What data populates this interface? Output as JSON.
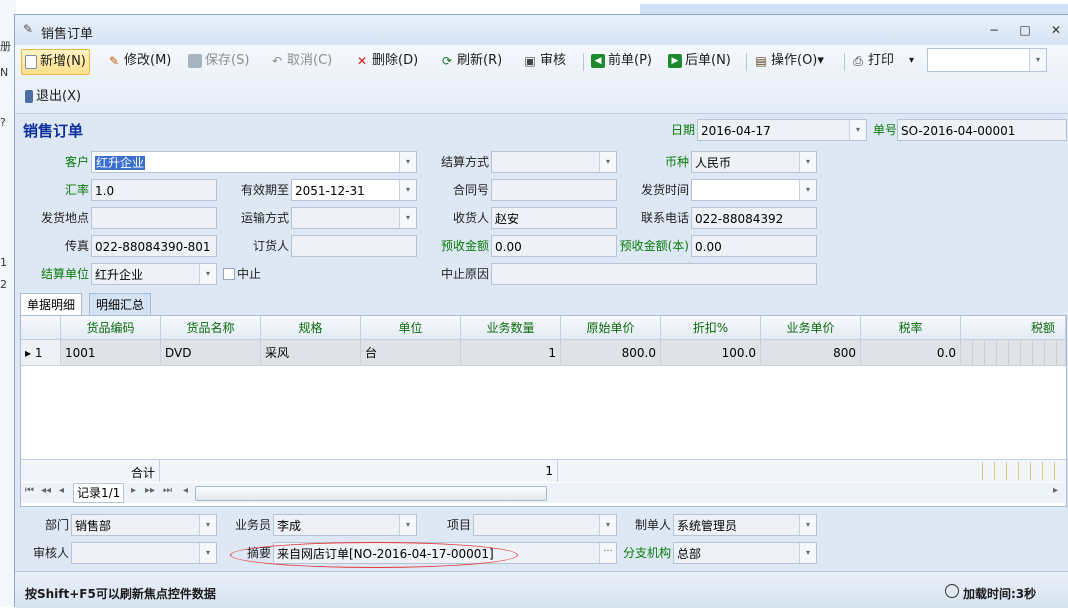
{
  "background_app": {
    "fragments": [
      "册",
      "N",
      "?",
      "1",
      "2"
    ]
  },
  "window": {
    "title": "销售订单",
    "controls": [
      "−",
      "□",
      "✕"
    ]
  },
  "toolbar": {
    "items": [
      {
        "label": "新增(N)",
        "icon": "new-doc-icon",
        "enabled": true,
        "selected": true
      },
      {
        "label": "修改(M)",
        "icon": "edit-icon",
        "enabled": true
      },
      {
        "label": "保存(S)",
        "icon": "save-icon",
        "enabled": false
      },
      {
        "label": "取消(C)",
        "icon": "undo-icon",
        "enabled": false
      },
      {
        "label": "删除(D)",
        "icon": "delete-icon",
        "enabled": true
      },
      {
        "label": "刷新(R)",
        "icon": "refresh-icon",
        "enabled": true
      },
      {
        "label": "审核",
        "icon": "audit-icon",
        "enabled": true
      },
      {
        "label": "前单(P)",
        "icon": "prev-icon",
        "enabled": true
      },
      {
        "label": "后单(N)",
        "icon": "next-icon",
        "enabled": true
      },
      {
        "label": "操作(O)▾",
        "icon": "operation-icon",
        "enabled": true
      },
      {
        "label": "打印",
        "icon": "print-icon",
        "enabled": true
      },
      {
        "label": "▾",
        "icon": "",
        "enabled": true
      },
      {
        "label": "退出(X)",
        "icon": "exit-icon",
        "enabled": true
      }
    ],
    "search_value": ""
  },
  "form": {
    "title": "销售订单",
    "date_label": "日期",
    "date_value": "2016-04-17",
    "no_label": "单号",
    "no_value": "SO-2016-04-00001",
    "fields": {
      "customer": {
        "label": "客户",
        "value": "红升企业"
      },
      "settle_method": {
        "label": "结算方式",
        "value": ""
      },
      "currency": {
        "label": "币种",
        "value": "人民币"
      },
      "rate": {
        "label": "汇率",
        "value": "1.0"
      },
      "valid_until": {
        "label": "有效期至",
        "value": "2051-12-31"
      },
      "contract_no": {
        "label": "合同号",
        "value": ""
      },
      "ship_time": {
        "label": "发货时间",
        "value": ""
      },
      "ship_place": {
        "label": "发货地点",
        "value": ""
      },
      "transport": {
        "label": "运输方式",
        "value": ""
      },
      "receiver": {
        "label": "收货人",
        "value": "赵安"
      },
      "phone": {
        "label": "联系电话",
        "value": "022-88084392"
      },
      "fax": {
        "label": "传真",
        "value": "022-88084390-801"
      },
      "orderer": {
        "label": "订货人",
        "value": ""
      },
      "prepaid": {
        "label": "预收金额",
        "value": "0.00"
      },
      "prepaid_base": {
        "label": "预收金额(本)",
        "value": "0.00"
      },
      "settle_unit": {
        "label": "结算单位",
        "value": "红升企业"
      },
      "stop_label": "中止",
      "stop_reason": {
        "label": "中止原因",
        "value": ""
      }
    }
  },
  "tabs": [
    {
      "label": "单据明细",
      "active": true
    },
    {
      "label": "明细汇总",
      "active": false
    }
  ],
  "grid": {
    "columns": [
      "",
      "货品编码",
      "货品名称",
      "规格",
      "单位",
      "业务数量",
      "原始单价",
      "折扣%",
      "业务单价",
      "税率",
      "税额"
    ],
    "rows": [
      {
        "indicator": "▸ 1",
        "cells": [
          "1001",
          "DVD",
          "采风",
          "台",
          "1",
          "800.0",
          "100.0",
          "800",
          "0.0",
          ""
        ]
      }
    ],
    "footer": {
      "label": "合计",
      "qty_total": "1"
    },
    "nav": {
      "record_text": "记录1/1",
      "buttons": [
        "⏮",
        "◂◂",
        "◂",
        "▸",
        "▸▸",
        "⏭"
      ]
    }
  },
  "bottom": {
    "dept": {
      "label": "部门",
      "value": "销售部"
    },
    "salesman": {
      "label": "业务员",
      "value": "李成"
    },
    "project": {
      "label": "项目",
      "value": ""
    },
    "maker": {
      "label": "制单人",
      "value": "系统管理员"
    },
    "auditor": {
      "label": "审核人",
      "value": ""
    },
    "summary": {
      "label": "摘要",
      "value": "来自网店订单[NO-2016-04-17-00001]"
    },
    "branch": {
      "label": "分支机构",
      "value": "总部"
    }
  },
  "status": {
    "hint": "按Shift+F5可以刷新焦点控件数据",
    "load_time": "加载时间:3秒"
  },
  "colors": {
    "accent": "#0d2e9e",
    "label_green": "#0a7a0a",
    "highlight": "#e23b3b"
  }
}
